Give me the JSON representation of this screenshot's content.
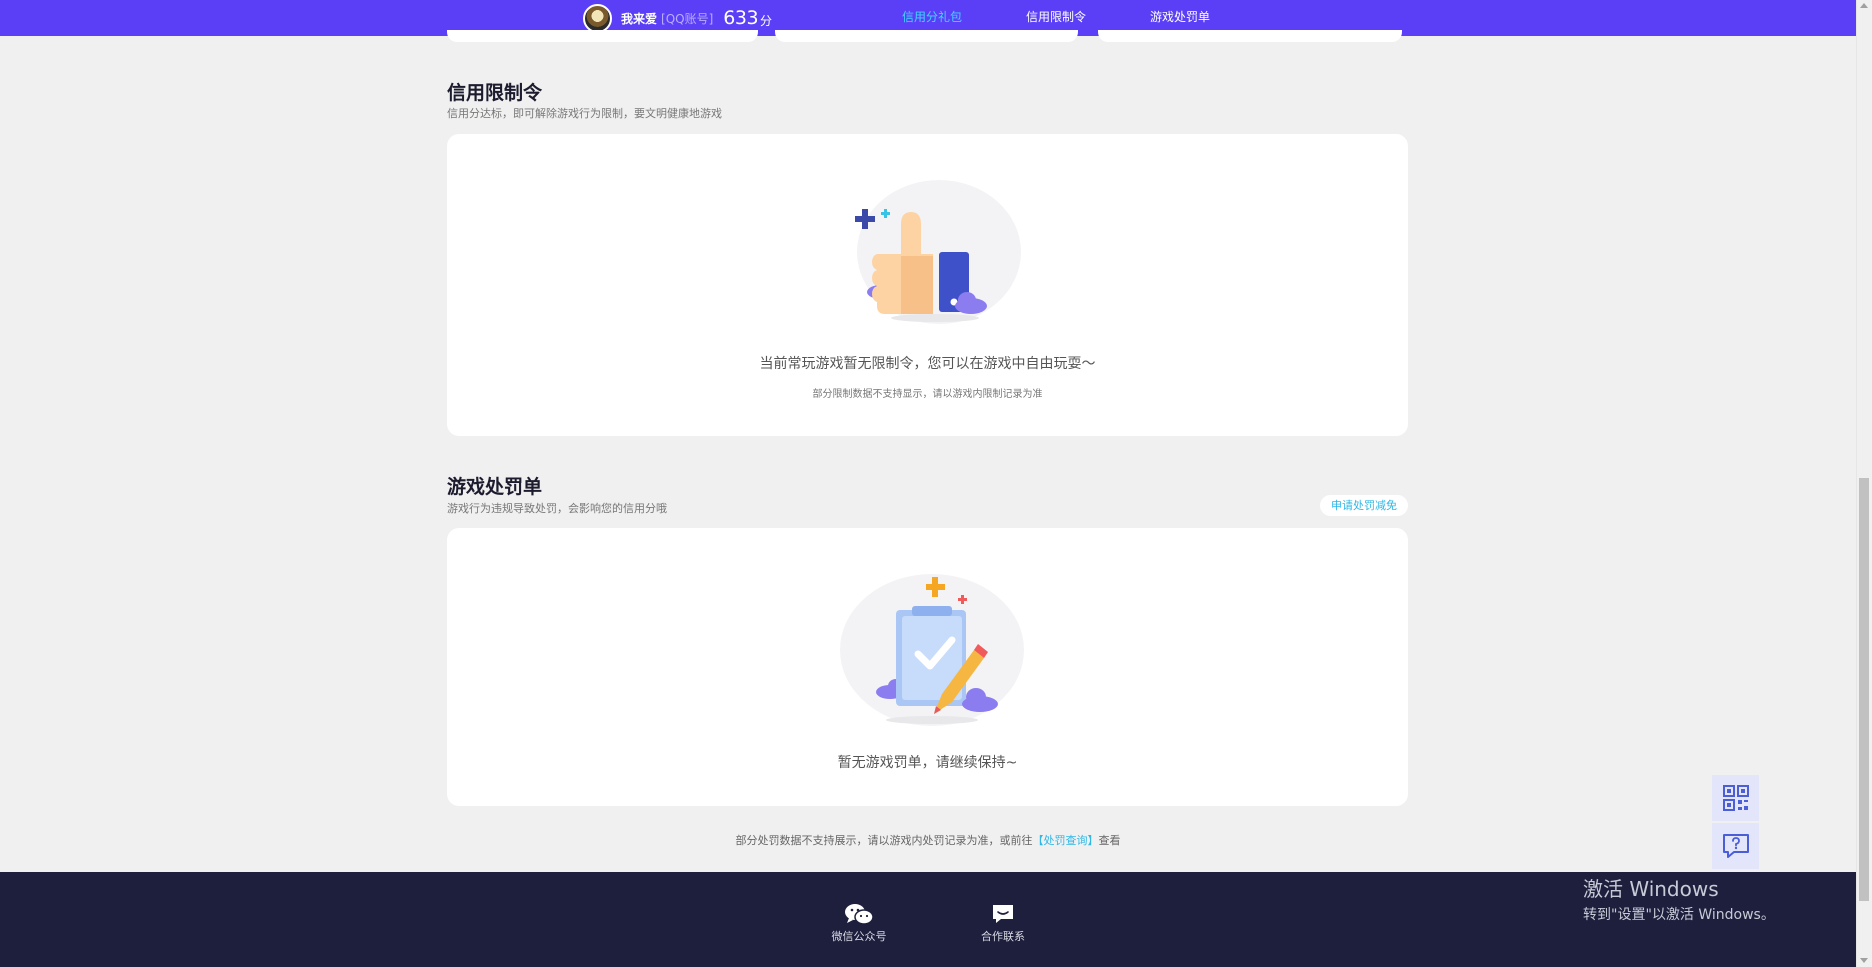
{
  "topnav": {
    "user_name": "我来爱",
    "account_tag": "[QQ账号]",
    "score": "633",
    "score_unit": "分",
    "tabs": [
      {
        "label": "信用分礼包",
        "active": true
      },
      {
        "label": "信用限制令",
        "active": false
      },
      {
        "label": "游戏处罚单",
        "active": false
      }
    ],
    "bg_color": "#5a3ff6",
    "active_color": "#3fd6ff"
  },
  "restriction": {
    "title": "信用限制令",
    "subtitle": "信用分达标，即可解除游戏行为限制，要文明健康地游戏",
    "empty_message": "当前常玩游戏暂无限制令，您可以在游戏中自由玩耍～",
    "empty_note": "部分限制数据不支持显示，请以游戏内限制记录为准",
    "illustration_icon": "thumbs-up-icon"
  },
  "penalty": {
    "title": "游戏处罚单",
    "subtitle": "游戏行为违规导致处罚，会影响您的信用分哦",
    "appeal_button": "申请处罚减免",
    "empty_message": "暂无游戏罚单，请继续保持~",
    "illustration_icon": "clipboard-check-icon"
  },
  "footnote": {
    "prefix": "部分处罚数据不支持展示，请以游戏内处罚记录为准，或前往",
    "link": "【处罚查询】",
    "suffix": "查看"
  },
  "footer": {
    "items": [
      {
        "label": "微信公众号",
        "icon": "wechat-icon"
      },
      {
        "label": "合作联系",
        "icon": "chat-icon"
      }
    ],
    "bg_color": "#1e1f3c"
  },
  "side_buttons": [
    {
      "icon": "qr-code-icon"
    },
    {
      "icon": "help-chat-icon"
    }
  ],
  "os_watermark": {
    "line1": "激活 Windows",
    "line2": "转到\"设置\"以激活 Windows。"
  }
}
